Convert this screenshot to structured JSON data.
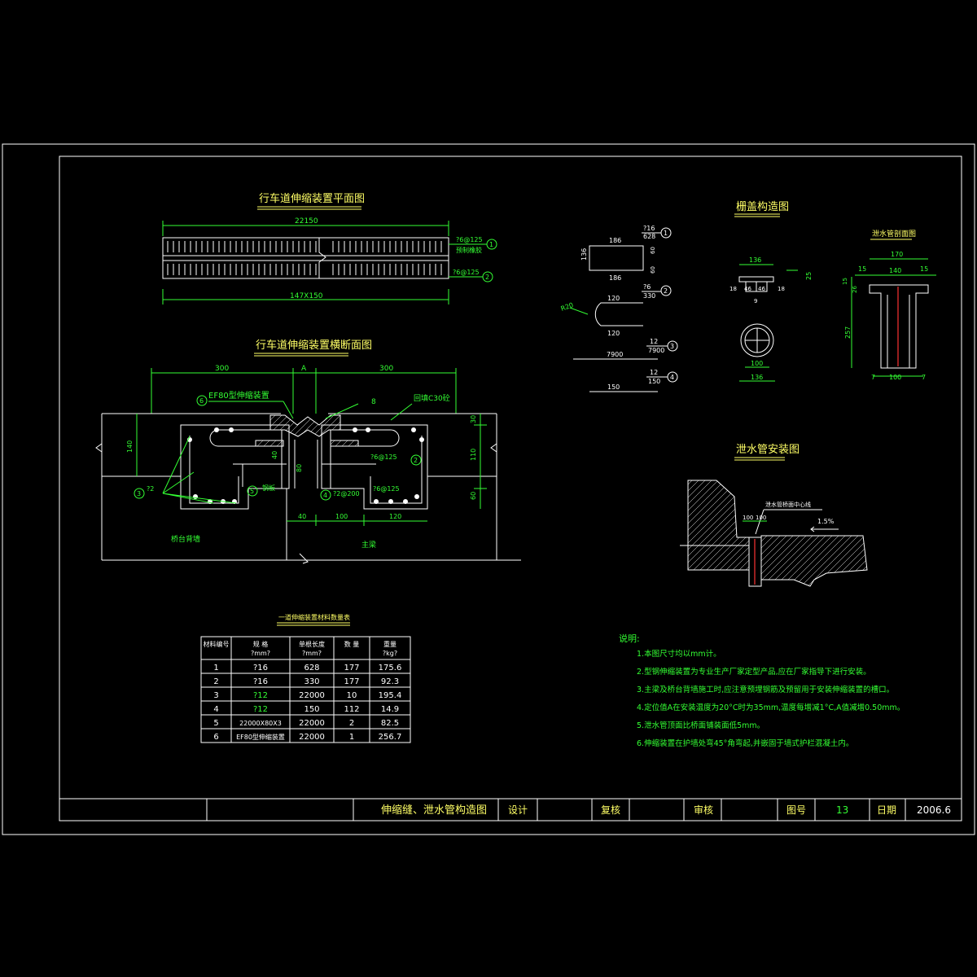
{
  "colors": {
    "background": "#000000",
    "frame": "#ffffff",
    "dimension": "#33ff33",
    "rebar": "#ffffff",
    "title_text": "#ffff66",
    "accent": "#ff3333"
  },
  "views": {
    "plan": {
      "title": "行车道伸缩装置平面图",
      "total": "22150",
      "spacing": "147X150",
      "callout1_a": "?6@125",
      "callout1_b": "预制橡胶",
      "callout2": "?6@125",
      "mark1": "1",
      "mark2": "2"
    },
    "section": {
      "title": "行车道伸缩装置横断面图",
      "dim_left": "300",
      "dim_gap": "A",
      "dim_right": "300",
      "dim_140": "140",
      "dim_30": "30",
      "dim_110": "110",
      "dim_60": "60",
      "dim_40a": "40",
      "dim_80": "80",
      "dim_40": "40",
      "dim_100": "100",
      "dim_120": "120",
      "device_label": "EF80型伸缩装置",
      "mark6": "6",
      "mark8": "8",
      "concrete": "回填C30砼",
      "rebar_a": "?6@125",
      "rebar_b": "?6@125",
      "rebar_c": "?2@200",
      "mark2": "2",
      "mark3": "3",
      "mark4": "4",
      "mark5": "5",
      "mark22": "?2",
      "steel_plate": "钢板",
      "abutment": "桥台背墙",
      "girder": "主梁"
    },
    "rebar": {
      "r1_top": "186",
      "r1_left": "136",
      "r1_bottom": "186",
      "r1_r1": "60",
      "r1_r2": "60",
      "r1_spec": "?16",
      "r1_len": "628",
      "r2_top": "120",
      "r2_bottom": "120",
      "r2_radius": "R20",
      "r2_spec": "?6",
      "r2_len": "330",
      "r3_len": "7900",
      "r3_spec": "12",
      "r3_total": "7900",
      "r4_len": "150",
      "r4_spec": "12",
      "r4_total": "150",
      "m1": "1",
      "m2": "2",
      "m3": "3",
      "m4": "4"
    },
    "cover": {
      "title": "栅盖构造图",
      "d136": "136",
      "d18a": "18",
      "d46a": "46",
      "d46b": "46",
      "d18b": "18",
      "d9": "9",
      "d25": "25",
      "d100": "100",
      "d136b": "136"
    },
    "pipe": {
      "title": "泄水管剖面图",
      "d170": "170",
      "d15a": "15",
      "d140": "140",
      "d15b": "15",
      "d15v": "15",
      "d26v": "26",
      "d257": "257",
      "d7a": "7",
      "d100": "100",
      "d7b": "7"
    },
    "install": {
      "title": "泄水管安装图",
      "note": "泄水管桥面中心线",
      "d100a": "100",
      "d100b": "100",
      "slope": "1.5%"
    }
  },
  "table": {
    "title": "一道伸缩装置材料数量表",
    "headers": [
      {
        "l1": "材料编号",
        "l2": ""
      },
      {
        "l1": "规 格",
        "l2": "?mm?"
      },
      {
        "l1": "单根长度",
        "l2": "?mm?"
      },
      {
        "l1": "数 量",
        "l2": ""
      },
      {
        "l1": "重量",
        "l2": "?kg?"
      }
    ],
    "rows": [
      {
        "no": "1",
        "spec": "?16",
        "len": "628",
        "qty": "177",
        "wt": "175.6"
      },
      {
        "no": "2",
        "spec": "?16",
        "len": "330",
        "qty": "177",
        "wt": "92.3"
      },
      {
        "no": "3",
        "spec": "?12",
        "len": "22000",
        "qty": "10",
        "wt": "195.4"
      },
      {
        "no": "4",
        "spec": "?12",
        "len": "150",
        "qty": "112",
        "wt": "14.9"
      },
      {
        "no": "5",
        "spec": "22000X80X3",
        "len": "22000",
        "qty": "2",
        "wt": "82.5"
      },
      {
        "no": "6",
        "spec": "EF80型伸缩装置",
        "len": "22000",
        "qty": "1",
        "wt": "256.7"
      }
    ]
  },
  "notes": {
    "heading": "说明:",
    "items": [
      "1.本图尺寸均以mm计。",
      "2.型钢伸缩装置为专业生产厂家定型产品,应在厂家指导下进行安装。",
      "3.主梁及桥台背墙施工时,应注意预埋钢筋及预留用于安装伸缩装置的槽口。",
      "4.定位值A在安装温度为20°C时为35mm,温度每增减1°C,A值减增0.50mm。",
      "5.泄水管顶面比桥面铺装面低5mm。",
      "6.伸缩装置在护墙处弯45°角弯起,并嵌固于墙式护栏混凝土内。"
    ]
  },
  "titleblock": {
    "drawing_title": "伸缩缝、泄水管构造图",
    "design": "设计",
    "check": "复核",
    "review": "审核",
    "number_label": "图号",
    "number": "13",
    "date_label": "日期",
    "date": "2006.6"
  }
}
